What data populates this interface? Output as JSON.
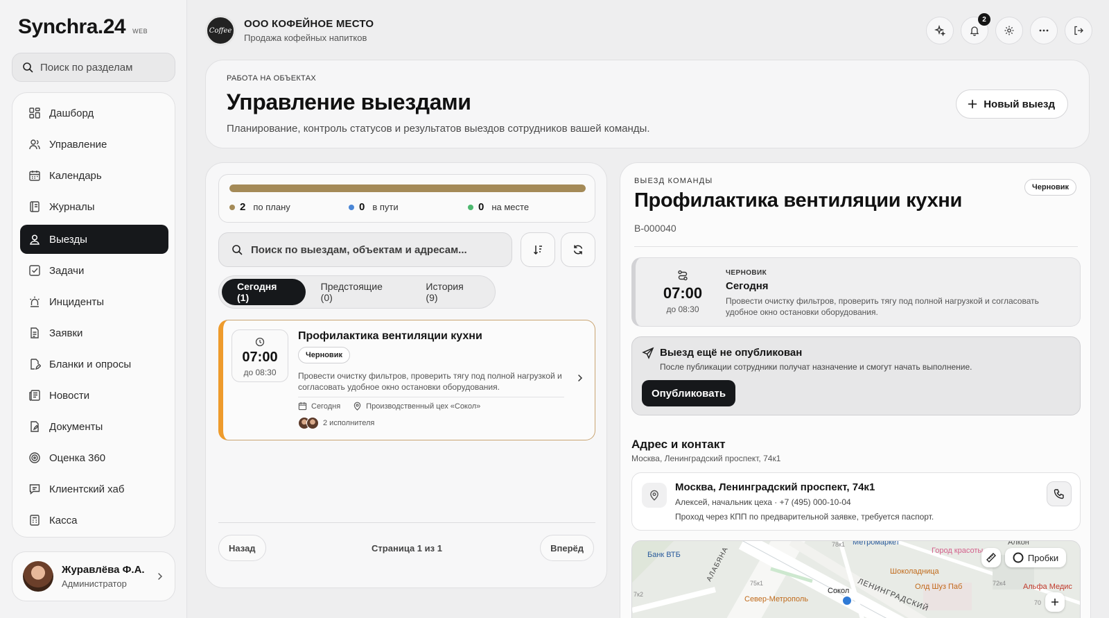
{
  "app": {
    "name": "Synchra.24",
    "tag": "WEB"
  },
  "sidebar": {
    "search_placeholder": "Поиск по разделам",
    "items": [
      {
        "label": "Дашборд",
        "icon": "dashboard-icon"
      },
      {
        "label": "Управление",
        "icon": "users-icon"
      },
      {
        "label": "Календарь",
        "icon": "calendar-icon"
      },
      {
        "label": "Журналы",
        "icon": "journal-icon"
      },
      {
        "label": "Выезды",
        "icon": "visits-icon",
        "active": true
      },
      {
        "label": "Задачи",
        "icon": "task-icon"
      },
      {
        "label": "Инциденты",
        "icon": "siren-icon"
      },
      {
        "label": "Заявки",
        "icon": "request-icon"
      },
      {
        "label": "Бланки и опросы",
        "icon": "form-icon"
      },
      {
        "label": "Новости",
        "icon": "news-icon"
      },
      {
        "label": "Документы",
        "icon": "document-icon"
      },
      {
        "label": "Оценка 360",
        "icon": "target-icon"
      },
      {
        "label": "Клиентский хаб",
        "icon": "chat-icon"
      },
      {
        "label": "Касса",
        "icon": "cash-icon"
      }
    ],
    "user": {
      "name": "Журавлёва Ф.А.",
      "role": "Администратор"
    }
  },
  "header": {
    "org_name": "ООО КОФЕЙНОЕ МЕСТО",
    "org_sub": "Продажа кофейных напитков",
    "logo_text": "Coffee",
    "notifications_count": "2"
  },
  "hero": {
    "kicker": "РАБОТА НА ОБЪЕКТАХ",
    "title": "Управление выездами",
    "desc": "Планирование, контроль статусов и результатов выездов сотрудников вашей команды.",
    "new_button": "Новый выезд"
  },
  "list": {
    "progress": 1.0,
    "stats": [
      {
        "value": "2",
        "label": "по плану",
        "color": "#a48a57"
      },
      {
        "value": "0",
        "label": "в пути",
        "color": "#4a86d6"
      },
      {
        "value": "0",
        "label": "на месте",
        "color": "#4cb86e"
      }
    ],
    "search_placeholder": "Поиск по выездам, объектам и адресам...",
    "tabs": [
      "Сегодня (1)",
      "Предстоящие (0)",
      "История (9)"
    ],
    "card": {
      "time": "07:00",
      "until": "до 08:30",
      "title": "Профилактика вентиляции кухни",
      "status": "Черновик",
      "desc": "Провести очистку фильтров, проверить тягу под полной нагрузкой и согласовать удобное окно остановки оборудования.",
      "day": "Сегодня",
      "place": "Производственный цех «Сокол»",
      "team": "2 исполнителя"
    },
    "pager": {
      "prev": "Назад",
      "text": "Страница 1 из 1",
      "next": "Вперёд"
    }
  },
  "detail": {
    "kicker": "ВЫЕЗД КОМАНДЫ",
    "status": "Черновик",
    "title": "Профилактика вентиляции кухни",
    "code": "В-000040",
    "schedule": {
      "time": "07:00",
      "until": "до 08:30",
      "kicker": "ЧЕРНОВИК",
      "day": "Сегодня",
      "desc": "Провести очистку фильтров, проверить тягу под полной нагрузкой и согласовать удобное окно остановки оборудования."
    },
    "publish": {
      "title": "Выезд ещё не опубликован",
      "desc": "После публикации сотрудники получат назначение и смогут начать выполнение.",
      "button": "Опубликовать"
    },
    "address": {
      "heading": "Адрес и контакт",
      "sub": "Москва, Ленинградский проспект, 74к1",
      "title": "Москва, Ленинградский проспект, 74к1",
      "person": "Алексей, начальник цеха · +7 (495) 000-10-04",
      "note": "Проход через КПП по предварительной заявке, требуется паспорт."
    },
    "map": {
      "labels": [
        "Банк ВТБ",
        "Метромаркет",
        "Город красоты",
        "Алкон",
        "Шоколадница",
        "Олд Шуз Паб",
        "Альфа Медис",
        "Север-Метрополь",
        "Сокол",
        "ЛЕНИНГРАДСКИЙ",
        "АЛАБЯНА",
        "75к1",
        "72к4",
        "78к1",
        "70",
        "7к2"
      ],
      "traffic_button": "Пробки"
    }
  }
}
